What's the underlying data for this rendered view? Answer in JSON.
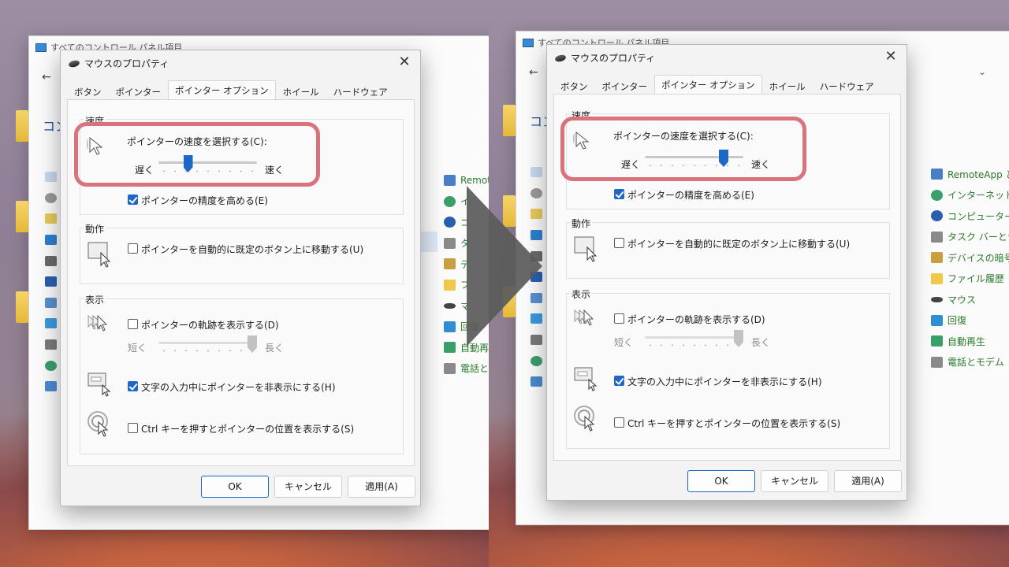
{
  "panels": {
    "left": {
      "cp_title": "すべてのコントロール パネル項目",
      "cp_heading": "コン",
      "cp_items": [
        "Remot",
        "イ",
        "コ",
        "タ",
        "デ",
        "フ",
        "マ",
        "回復",
        "自動再",
        "電話と"
      ],
      "dialog": {
        "title": "マウスのプロパティ",
        "tabs": [
          "ボタン",
          "ポインター",
          "ポインター オプション",
          "ホイール",
          "ハードウェア"
        ],
        "speed_group": "速度",
        "speed_label": "ポインターの速度を選択する(C):",
        "slow": "遅く",
        "fast": "速く",
        "speed_value": 0.3,
        "precision": "ポインターの精度を高める(E)",
        "action_group": "動作",
        "snap_to": "ポインターを自動的に既定のボタン上に移動する(U)",
        "visibility_group": "表示",
        "trails": "ポインターの軌跡を表示する(D)",
        "short": "短く",
        "long": "長く",
        "hide_typing": "文字の入力中にポインターを非表示にする(H)",
        "ctrl_locate": "Ctrl キーを押すとポインターの位置を表示する(S)",
        "ok": "OK",
        "cancel": "キャンセル",
        "apply": "適用(A)"
      }
    },
    "right": {
      "cp_title": "すべてのコントロール パネル項目",
      "cp_heading": "コン",
      "cp_items": [
        "RemoteApp と",
        "インターネット オ",
        "コンピューターの簡",
        "タスク バーとナビ",
        "デバイスの暗号化",
        "ファイル履歴",
        "マウス",
        "回復",
        "自動再生",
        "電話とモデム"
      ],
      "dialog": {
        "title": "マウスのプロパティ",
        "tabs": [
          "ボタン",
          "ポインター",
          "ポインター オプション",
          "ホイール",
          "ハードウェア"
        ],
        "speed_group": "速度",
        "speed_label": "ポインターの速度を選択する(C):",
        "slow": "遅く",
        "fast": "速く",
        "speed_value": 0.8,
        "precision": "ポインターの精度を高める(E)",
        "action_group": "動作",
        "snap_to": "ポインターを自動的に既定のボタン上に移動する(U)",
        "visibility_group": "表示",
        "trails": "ポインターの軌跡を表示する(D)",
        "short": "短く",
        "long": "長く",
        "hide_typing": "文字の入力中にポインターを非表示にする(H)",
        "ctrl_locate": "Ctrl キーを押すとポインターの位置を表示する(S)",
        "ok": "OK",
        "cancel": "キャンセル",
        "apply": "適用(A)"
      }
    }
  },
  "colors": {
    "accent": "#1d67c5",
    "highlight": "#d9727a",
    "link_green": "#2a7a2a",
    "heading_blue": "#1f4f99"
  }
}
